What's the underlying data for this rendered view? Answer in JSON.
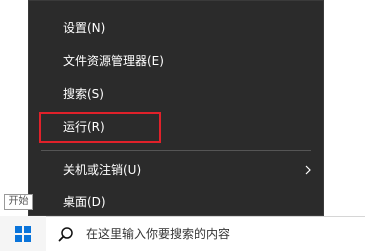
{
  "menu": {
    "items": [
      {
        "label": "设置(N)"
      },
      {
        "label": "文件资源管理器(E)"
      },
      {
        "label": "搜索(S)"
      },
      {
        "label": "运行(R)"
      },
      {
        "label": "关机或注销(U)",
        "submenu": true
      },
      {
        "label": "桌面(D)"
      }
    ]
  },
  "taskbar": {
    "start_tooltip": "开始",
    "search_placeholder": "在这里输入你要搜索的内容"
  },
  "colors": {
    "menu_bg": "#2b2b2b",
    "menu_text": "#ffffff",
    "highlight_border": "#e0212a",
    "start_icon": "#0a74da"
  },
  "icons": {
    "start": "windows-logo-icon",
    "search": "search-icon",
    "submenu": "chevron-right-icon"
  }
}
